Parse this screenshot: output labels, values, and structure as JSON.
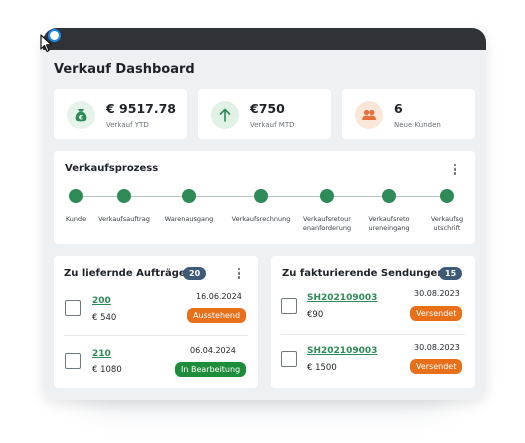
{
  "dashboard": {
    "title": "Verkauf Dashboard"
  },
  "kpis": [
    {
      "value": "€ 9517.78",
      "label": "Verkauf YTD",
      "icon": "money-bag-icon",
      "color": "#2e8b57"
    },
    {
      "value": "€750",
      "label": "Verkauf MTD",
      "icon": "arrow-up-icon",
      "color": "#2e8b57"
    },
    {
      "value": "6",
      "label": "Neue Kunden",
      "icon": "users-icon",
      "color": "#e8703a"
    }
  ],
  "process": {
    "title": "Verkaufsprozess",
    "steps": [
      {
        "label": "Kunde"
      },
      {
        "label": "Verkaufsauftrag"
      },
      {
        "label": "Warenausgang"
      },
      {
        "label": "Verkaufsrechnung"
      },
      {
        "label": "Verkaufsretour\nenanforderung"
      },
      {
        "label": "Verkaufsreto\nureneingang"
      },
      {
        "label": "Verkaufsg\nutschrift"
      }
    ]
  },
  "orders": {
    "title": "Zu liefernde Aufträge",
    "count": "20",
    "rows": [
      {
        "id": "200",
        "amount": "€ 540",
        "date": "16.06.2024",
        "status": "Ausstehend",
        "status_color": "#e8701a"
      },
      {
        "id": "210",
        "amount": "€ 1080",
        "date": "06.04.2024",
        "status": "In Bearbeitung",
        "status_color": "#1e8c3a"
      }
    ]
  },
  "shipments": {
    "title": "Zu fakturierende Sendungen",
    "count": "15",
    "rows": [
      {
        "id": "SH202109003",
        "amount": "€90",
        "date": "30.08.2023",
        "status": "Versendet",
        "status_color": "#e8701a"
      },
      {
        "id": "SH202109003",
        "amount": "€ 1500",
        "date": "30.08.2023",
        "status": "Versendet",
        "status_color": "#e8701a"
      }
    ]
  }
}
